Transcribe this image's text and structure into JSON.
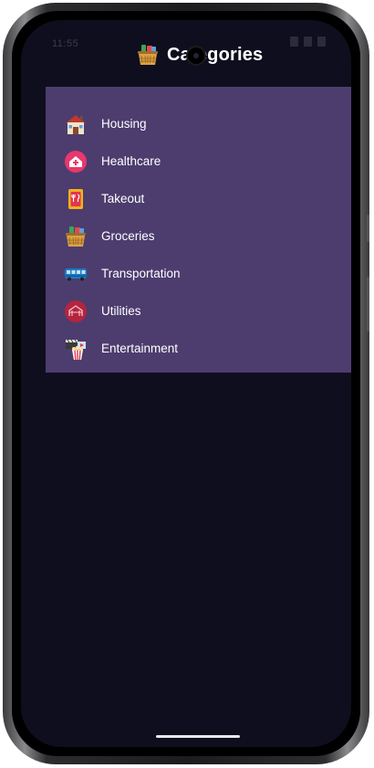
{
  "app": {
    "title": "Categories",
    "title_icon": "grocery-basket-icon"
  },
  "status_bar": {
    "time": "11:55"
  },
  "categories": [
    {
      "label": "Housing",
      "icon": "house-icon"
    },
    {
      "label": "Healthcare",
      "icon": "hospital-icon"
    },
    {
      "label": "Takeout",
      "icon": "takeout-menu-icon"
    },
    {
      "label": "Groceries",
      "icon": "grocery-basket-icon"
    },
    {
      "label": "Transportation",
      "icon": "bus-icon"
    },
    {
      "label": "Utilities",
      "icon": "utilities-icon"
    },
    {
      "label": "Entertainment",
      "icon": "movie-popcorn-icon"
    }
  ],
  "colors": {
    "screen_background": "#0f0e1e",
    "panel_background": "#4c3d6e",
    "text": "#ffffff"
  }
}
